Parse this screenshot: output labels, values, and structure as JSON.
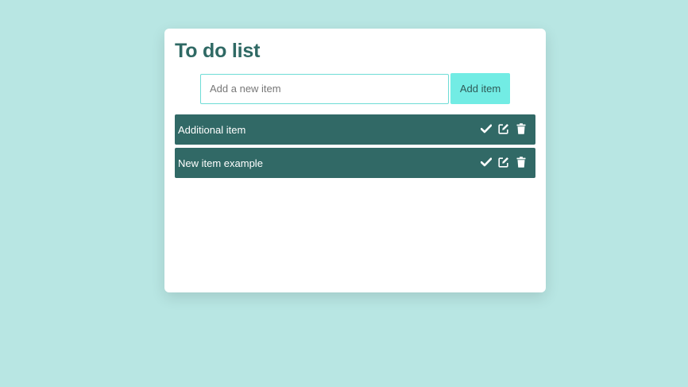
{
  "app": {
    "title": "To do list"
  },
  "add_form": {
    "placeholder": "Add a new item",
    "value": "",
    "button_label": "Add item"
  },
  "items": [
    {
      "text": "Additional item",
      "actions": [
        "check-icon",
        "edit-icon",
        "trash-icon"
      ]
    },
    {
      "text": "New item example",
      "actions": [
        "check-icon",
        "edit-icon",
        "trash-icon"
      ]
    }
  ],
  "colors": {
    "background": "#b8e6e3",
    "card": "#ffffff",
    "title": "#2f6964",
    "item_bg": "#316966",
    "input_border": "#6edcd6",
    "button_bg": "#72ece4"
  }
}
